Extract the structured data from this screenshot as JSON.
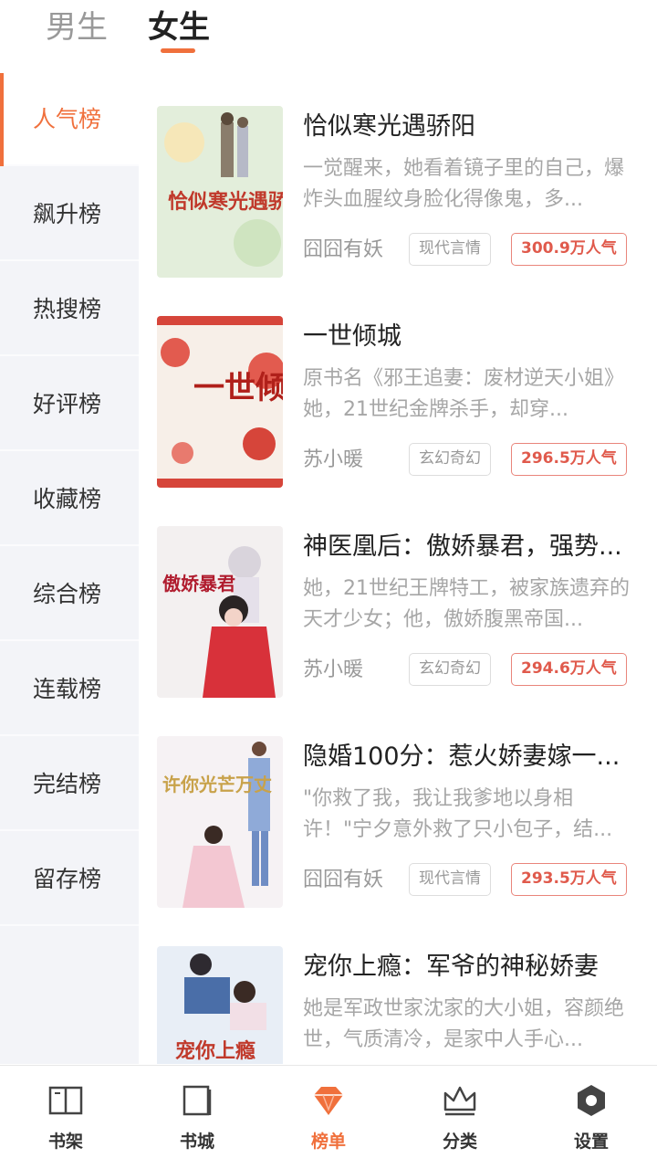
{
  "gender_tabs": [
    {
      "label": "男生",
      "active": false
    },
    {
      "label": "女生",
      "active": true
    }
  ],
  "accent_color": "#f0703c",
  "rank_menu": [
    {
      "label": "人气榜",
      "active": true
    },
    {
      "label": "飙升榜",
      "active": false
    },
    {
      "label": "热搜榜",
      "active": false
    },
    {
      "label": "好评榜",
      "active": false
    },
    {
      "label": "收藏榜",
      "active": false
    },
    {
      "label": "综合榜",
      "active": false
    },
    {
      "label": "连载榜",
      "active": false
    },
    {
      "label": "完结榜",
      "active": false
    },
    {
      "label": "留存榜",
      "active": false
    }
  ],
  "books": [
    {
      "title": "恰似寒光遇骄阳",
      "description": "一觉醒来，她看着镜子里的自己，爆炸头血腥纹身脸化得像鬼，多...",
      "author": "囧囧有妖",
      "tag": "现代言情",
      "popularity": "300.9万人气",
      "cover_title": "恰似寒光遇骄阳"
    },
    {
      "title": "一世倾城",
      "description": "原书名《邪王追妻：废材逆天小姐》她，21世纪金牌杀手，却穿...",
      "author": "苏小暖",
      "tag": "玄幻奇幻",
      "popularity": "296.5万人气",
      "cover_title": "一世倾城"
    },
    {
      "title": "神医凰后：傲娇暴君，强势...",
      "description": "她，21世纪王牌特工，被家族遗弃的天才少女；他，傲娇腹黑帝国...",
      "author": "苏小暖",
      "tag": "玄幻奇幻",
      "popularity": "294.6万人气",
      "cover_title": "傲娇暴君"
    },
    {
      "title": "隐婚100分：惹火娇妻嫁一...",
      "description": "\"你救了我，我让我爹地以身相许！\"宁夕意外救了只小包子，结...",
      "author": "囧囧有妖",
      "tag": "现代言情",
      "popularity": "293.5万人气",
      "cover_title": "许你光芒万丈"
    },
    {
      "title": "宠你上瘾：军爷的神秘娇妻",
      "description": "她是军政世家沈家的大小姐，容颜绝世，气质清冷，是家中人手心...",
      "author": "",
      "tag": "",
      "popularity": "",
      "cover_title": "宠你上瘾"
    }
  ],
  "bottom_nav": [
    {
      "label": "书架",
      "icon": "bookshelf-icon",
      "active": false
    },
    {
      "label": "书城",
      "icon": "bookstore-icon",
      "active": false
    },
    {
      "label": "榜单",
      "icon": "diamond-icon",
      "active": true
    },
    {
      "label": "分类",
      "icon": "crown-icon",
      "active": false
    },
    {
      "label": "设置",
      "icon": "hexagon-settings-icon",
      "active": false
    }
  ]
}
